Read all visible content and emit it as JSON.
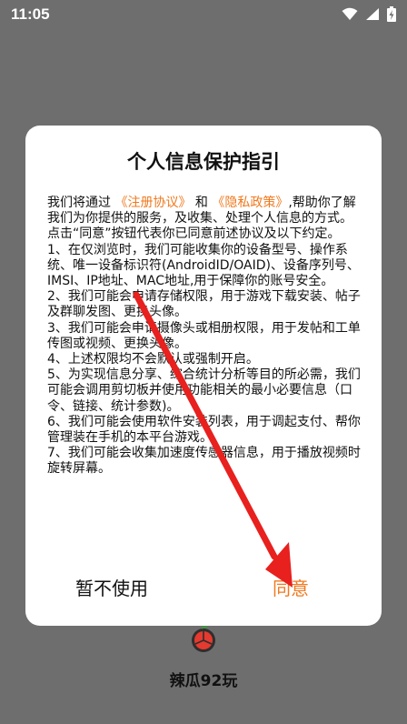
{
  "status": {
    "time": "11:05",
    "icons": [
      "wifi-icon",
      "signal-icon",
      "battery-icon"
    ]
  },
  "dialog": {
    "title": "个人信息保护指引",
    "intro_prefix": "我们将通过",
    "link_register": "《注册协议》",
    "intro_and": "和",
    "link_privacy": "《隐私政策》",
    "intro_suffix": ",帮助你了解我们为你提供的服务，及收集、处理个人信息的方式。",
    "paragraphs": [
      "点击“同意”按钮代表你已同意前述协议及以下约定。",
      "1、在仅浏览时，我们可能收集你的设备型号、操作系统、唯一设备标识符(AndroidID/OAID)、设备序列号、IMSI、IP地址、MAC地址,用于保障你的账号安全。",
      "2、我们可能会申请存储权限，用于游戏下载安装、帖子及群聊发图、更换头像。",
      "3、我们可能会申请摄像头或相册权限，用于发帖和工单传图或视频、更换头像。",
      "4、上述权限均不会默认或强制开启。",
      "5、为实现信息分享、综合统计分析等目的所必需，我们可能会调用剪切板并使用功能相关的最小必要信息（口令、链接、统计参数)。",
      "6、我们可能会使用软件安装列表，用于调起支付、帮你管理装在手机的本平台游戏。",
      "7、我们可能会收集加速度传感器信息，用于播放视频时旋转屏幕。"
    ],
    "decline_label": "暂不使用",
    "agree_label": "同意"
  },
  "app": {
    "name": "辣瓜92玩"
  },
  "colors": {
    "accent": "#f0791e",
    "arrow": "#e8201e",
    "backdrop": "#6e6e6e"
  }
}
